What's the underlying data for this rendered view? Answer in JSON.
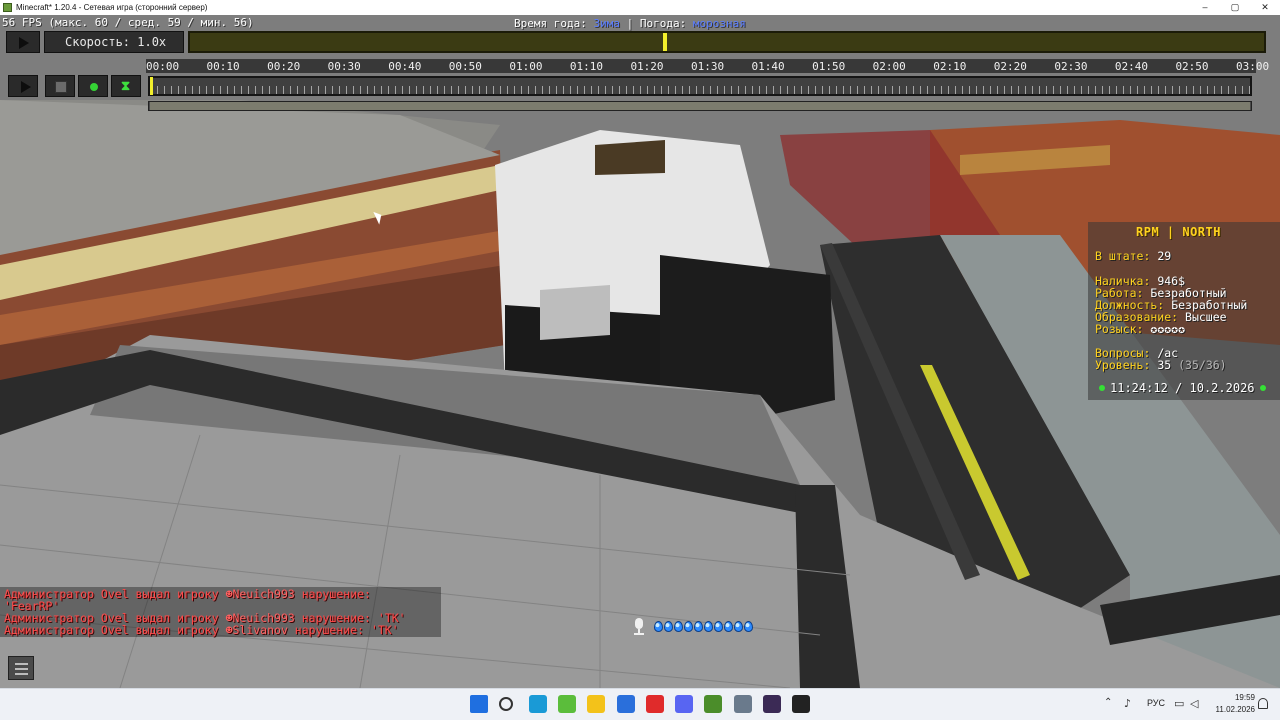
{
  "window": {
    "title": "Minecraft* 1.20.4 - Сетевая игра (сторонний сервер)",
    "controls": [
      "–",
      "▢",
      "✕"
    ]
  },
  "overlay": {
    "fps": "56 FPS (макс. 60 / сред. 59 / мин. 56)",
    "season_label": "Время года:",
    "season_value": "Зима",
    "weather_label": "| Погода:",
    "weather_value": "морозная"
  },
  "replay": {
    "speed": "Скорость: 1.0x",
    "progress_fraction": 0.44,
    "timeline_labels": [
      "00:00",
      "00:10",
      "00:20",
      "00:30",
      "00:40",
      "00:50",
      "01:00",
      "01:10",
      "01:20",
      "01:30",
      "01:40",
      "01:50",
      "02:00",
      "02:10",
      "02:20",
      "02:30",
      "02:40",
      "02:50",
      "03:00"
    ],
    "buttons": [
      "play-icon",
      "save-icon",
      "keyframe-icon",
      "time-path-icon"
    ],
    "accent_color": "#f2ef2c"
  },
  "hud": {
    "title": "RPM | NORTH",
    "staff_label": "В штате:",
    "staff_value": "29",
    "cash_label": "Наличка:",
    "cash_value": "946$",
    "job_label": "Работа:",
    "job_value": "Безработный",
    "position_label": "Должность:",
    "position_value": "Безработный",
    "education_label": "Образование:",
    "education_value": "Высшее",
    "wanted_label": "Розыск:",
    "wanted_value": "✪✪✪✪✪",
    "questions_label": "Вопросы:",
    "questions_value": "/ac",
    "level_label": "Уровень:",
    "level_value": "35",
    "level_progress": "(35/36)",
    "time": "11:24:12",
    "date_sep": "/",
    "date": "10.2.2026",
    "accent_color": "#ffd21f"
  },
  "chat": {
    "messages": [
      {
        "prefix": "Администратор Ovel выдал игроку ",
        "player": "☻Neuich993",
        "suffix": " нарушение:"
      },
      {
        "prefix": " 'FearRP'",
        "player": "",
        "suffix": ""
      },
      {
        "prefix": "Администратор Ovel выдал игроку ",
        "player": "☻Neuich993",
        "suffix": " нарушение: 'TK'"
      },
      {
        "prefix": "Администратор Ovel выдал игроку ",
        "player": "☻Slivanov",
        "suffix": " нарушение: 'TK'"
      }
    ],
    "color": "#ff4a4a"
  },
  "air_bubbles": 10,
  "taskbar": {
    "icons": [
      "windows-start-icon",
      "search-icon",
      "edge-icon",
      "minecraft-icon",
      "file-explorer-icon",
      "store-icon",
      "youtube-icon",
      "discord-icon",
      "minecraft-launcher-icon",
      "settings-icon",
      "obs-icon",
      "app-icon"
    ],
    "language": "РУС",
    "time": "19:59",
    "date": "11.02.2026"
  }
}
